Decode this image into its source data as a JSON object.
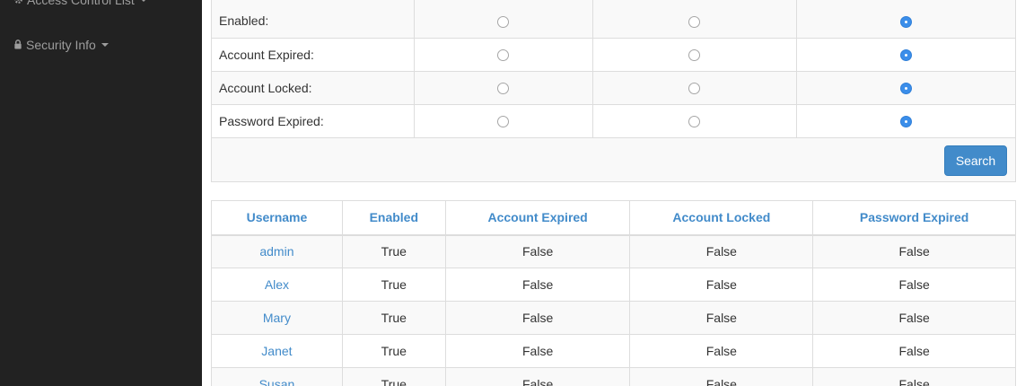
{
  "sidebar": {
    "items": [
      {
        "label": "Access Control List",
        "icon": "gear-icon"
      },
      {
        "label": "Security Info",
        "icon": "lock-icon"
      }
    ]
  },
  "filter": {
    "rows": [
      {
        "label": "Enabled:",
        "selected": 2
      },
      {
        "label": "Account Expired:",
        "selected": 2
      },
      {
        "label": "Account Locked:",
        "selected": 2
      },
      {
        "label": "Password Expired:",
        "selected": 2
      }
    ],
    "search_label": "Search"
  },
  "results": {
    "headers": [
      "Username",
      "Enabled",
      "Account Expired",
      "Account Locked",
      "Password Expired"
    ],
    "rows": [
      [
        "admin",
        "True",
        "False",
        "False",
        "False"
      ],
      [
        "Alex",
        "True",
        "False",
        "False",
        "False"
      ],
      [
        "Mary",
        "True",
        "False",
        "False",
        "False"
      ],
      [
        "Janet",
        "True",
        "False",
        "False",
        "False"
      ],
      [
        "Susan",
        "True",
        "False",
        "False",
        "False"
      ]
    ]
  },
  "colors": {
    "sidebar_bg": "#222222",
    "link": "#428bca",
    "button": "#428bca",
    "radio_checked": "#3b8eea"
  }
}
